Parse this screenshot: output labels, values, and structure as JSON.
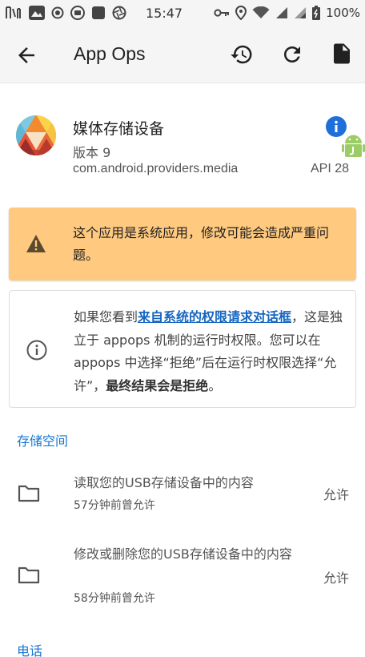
{
  "status_bar": {
    "time": "15:47",
    "battery": "100%",
    "icons": [
      "radio-icon",
      "mountain-notification-icon",
      "record-icon",
      "mi-icon",
      "square-icon",
      "aperture-icon",
      "key-icon",
      "location-icon",
      "wifi-icon",
      "signal-icon",
      "signal-icon",
      "battery-icon"
    ]
  },
  "app_bar": {
    "title": "App Ops",
    "icons": [
      "back-arrow-icon",
      "restore-icon",
      "refresh-icon",
      "document-icon"
    ]
  },
  "app_info": {
    "name": "媒体存储设备",
    "version": "版本 9",
    "package": "com.android.providers.media",
    "api": "API 28",
    "icons": [
      "app-logo-icon",
      "info-icon",
      "android-icon"
    ]
  },
  "warning": {
    "text": "这个应用是系统应用，修改可能会造成严重问题。",
    "icon": "warning-icon"
  },
  "note": {
    "prefix": "如果您看到",
    "link": "来自系统的权限请求对话框",
    "middle": "，这是独立于 appops 机制的运行时权限。您可以在 appops 中选择“拒绝”后在运行时权限选择“允许”，",
    "bold": "最终结果会是拒绝",
    "suffix": "。",
    "icon": "info-outline-icon"
  },
  "sections": [
    {
      "header": "存储空间",
      "permissions": [
        {
          "title": "读取您的USB存储设备中的内容",
          "subtitle": "57分钟前曾允许",
          "value": "允许",
          "icon": "folder-icon"
        },
        {
          "title": "修改或删除您的USB存储设备中的内容",
          "subtitle": "58分钟前曾允许",
          "value": "允许",
          "icon": "folder-icon"
        }
      ]
    },
    {
      "header": "电话",
      "permissions": []
    }
  ],
  "colors": {
    "accent": "#1976d2",
    "warning_background": "#ffc97f",
    "app_bar_background": "#f5f5f5"
  }
}
